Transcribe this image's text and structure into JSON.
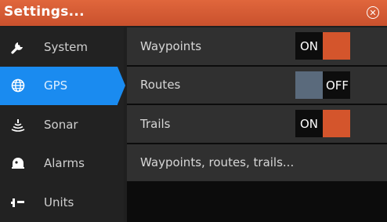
{
  "window": {
    "title": "Settings..."
  },
  "sidebar": {
    "items": [
      {
        "label": "System",
        "icon": "wrench-icon",
        "active": false
      },
      {
        "label": "GPS",
        "icon": "globe-icon",
        "active": true
      },
      {
        "label": "Sonar",
        "icon": "sonar-icon",
        "active": false
      },
      {
        "label": "Alarms",
        "icon": "alarm-icon",
        "active": false
      },
      {
        "label": "Units",
        "icon": "units-icon",
        "active": false
      }
    ]
  },
  "gps": {
    "rows": [
      {
        "label": "Waypoints",
        "toggle": "ON"
      },
      {
        "label": "Routes",
        "toggle": "OFF"
      },
      {
        "label": "Trails",
        "toggle": "ON"
      },
      {
        "label": "Waypoints, routes, trails..."
      }
    ]
  },
  "colors": {
    "title_bar": "#d45a31",
    "active_item": "#1a8bf0",
    "toggle_on": "#d4552c",
    "toggle_off": "#5a6a7c"
  }
}
